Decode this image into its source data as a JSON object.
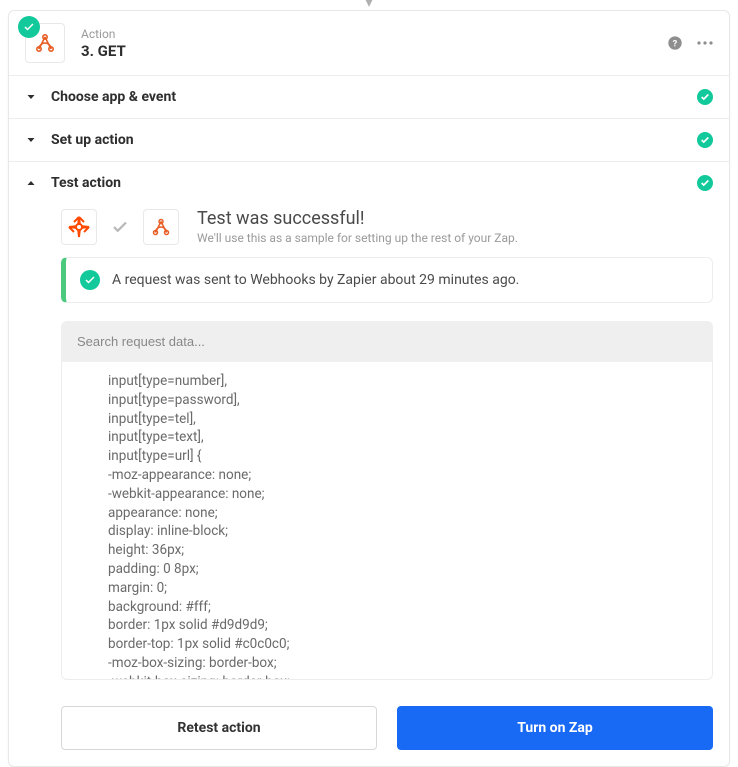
{
  "header": {
    "action_label": "Action",
    "title": "3. GET"
  },
  "sections": {
    "choose": {
      "label": "Choose app & event"
    },
    "setup": {
      "label": "Set up action"
    },
    "test": {
      "label": "Test action"
    }
  },
  "result": {
    "title": "Test was successful!",
    "subtitle": "We'll use this as a sample for setting up the rest of your Zap."
  },
  "notice": {
    "text": "A request was sent to Webhooks by Zapier about 29 minutes ago."
  },
  "search": {
    "placeholder": "Search request data..."
  },
  "data_lines": [
    "input[type=number],",
    "input[type=password],",
    "input[type=tel],",
    "input[type=text],",
    "input[type=url] {",
    "-moz-appearance: none;",
    "-webkit-appearance: none;",
    "appearance: none;",
    "display: inline-block;",
    "height: 36px;",
    "padding: 0 8px;",
    "margin: 0;",
    "background: #fff;",
    "border: 1px solid #d9d9d9;",
    "border-top: 1px solid #c0c0c0;",
    "-moz-box-sizing: border-box;",
    "-webkit-box-sizing: border-box;"
  ],
  "buttons": {
    "retest": "Retest action",
    "turn_on": "Turn on Zap"
  }
}
